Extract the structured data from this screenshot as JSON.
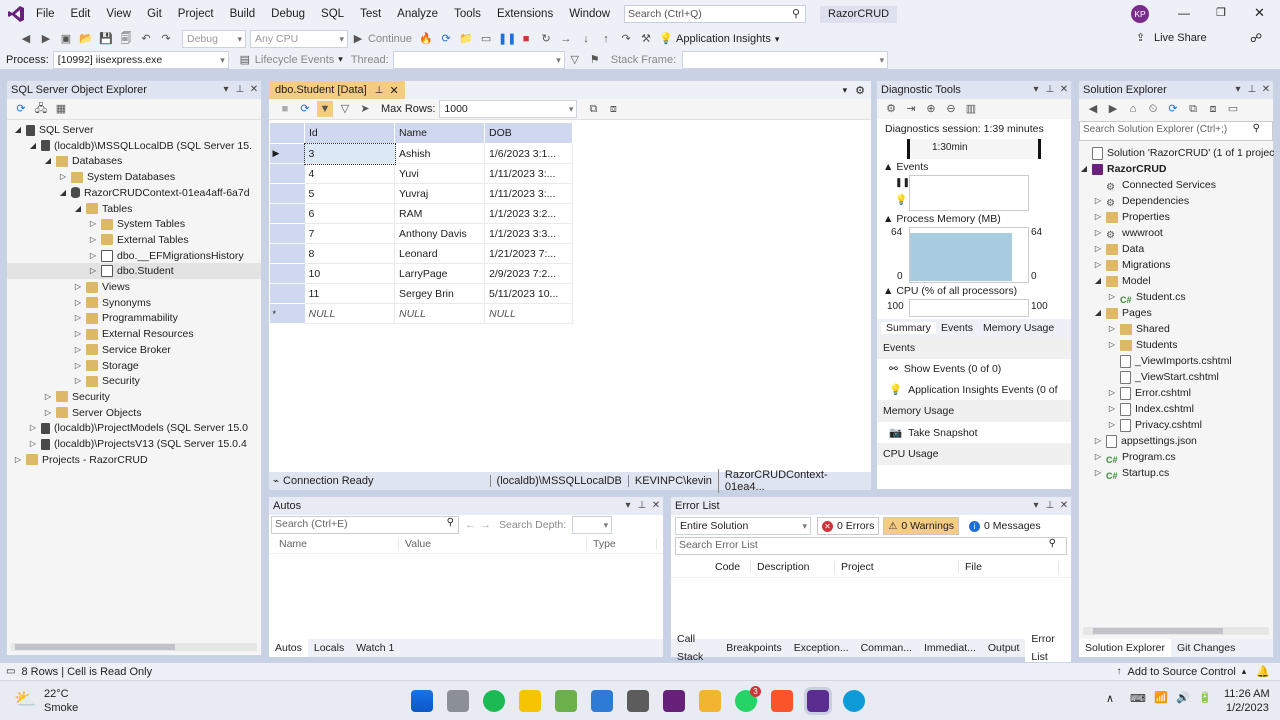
{
  "menu": {
    "items": [
      "File",
      "Edit",
      "View",
      "Git",
      "Project",
      "Build",
      "Debug",
      "SQL",
      "Test",
      "Analyze",
      "Tools",
      "Extensions",
      "Window",
      "Help"
    ],
    "search_placeholder": "Search (Ctrl+Q)",
    "solution_name": "RazorCRUD",
    "user_initials": "KP"
  },
  "toolbar": {
    "config": "Debug",
    "platform": "Any CPU",
    "continue_label": "Continue",
    "app_insights": "Application Insights",
    "live_share": "Live Share"
  },
  "toolbar2": {
    "process_label": "Process:",
    "process_value": "[10992] iisexpress.exe",
    "lifecycle": "Lifecycle Events",
    "thread_label": "Thread:",
    "stack_frame_label": "Stack Frame:"
  },
  "sql_explorer": {
    "title": "SQL Server Object Explorer",
    "nodes": [
      {
        "label": "SQL Server",
        "indent": 0,
        "arrow": "◢",
        "icon": "server"
      },
      {
        "label": "(localdb)\\MSSQLLocalDB (SQL Server 15.",
        "indent": 1,
        "arrow": "◢",
        "icon": "server"
      },
      {
        "label": "Databases",
        "indent": 2,
        "arrow": "◢",
        "icon": "folder"
      },
      {
        "label": "System Databases",
        "indent": 3,
        "arrow": "▷",
        "icon": "folder"
      },
      {
        "label": "RazorCRUDContext-01ea4aff-6a7d",
        "indent": 3,
        "arrow": "◢",
        "icon": "db"
      },
      {
        "label": "Tables",
        "indent": 4,
        "arrow": "◢",
        "icon": "folder"
      },
      {
        "label": "System Tables",
        "indent": 5,
        "arrow": "▷",
        "icon": "folder"
      },
      {
        "label": "External Tables",
        "indent": 5,
        "arrow": "▷",
        "icon": "folder"
      },
      {
        "label": "dbo.__EFMigrationsHistory",
        "indent": 5,
        "arrow": "▷",
        "icon": "table"
      },
      {
        "label": "dbo.Student",
        "indent": 5,
        "arrow": "▷",
        "icon": "table",
        "selected": true
      },
      {
        "label": "Views",
        "indent": 4,
        "arrow": "▷",
        "icon": "folder"
      },
      {
        "label": "Synonyms",
        "indent": 4,
        "arrow": "▷",
        "icon": "folder"
      },
      {
        "label": "Programmability",
        "indent": 4,
        "arrow": "▷",
        "icon": "folder"
      },
      {
        "label": "External Resources",
        "indent": 4,
        "arrow": "▷",
        "icon": "folder"
      },
      {
        "label": "Service Broker",
        "indent": 4,
        "arrow": "▷",
        "icon": "folder"
      },
      {
        "label": "Storage",
        "indent": 4,
        "arrow": "▷",
        "icon": "folder"
      },
      {
        "label": "Security",
        "indent": 4,
        "arrow": "▷",
        "icon": "folder"
      },
      {
        "label": "Security",
        "indent": 2,
        "arrow": "▷",
        "icon": "folder"
      },
      {
        "label": "Server Objects",
        "indent": 2,
        "arrow": "▷",
        "icon": "folder"
      },
      {
        "label": "(localdb)\\ProjectModels (SQL Server 15.0",
        "indent": 1,
        "arrow": "▷",
        "icon": "server"
      },
      {
        "label": "(localdb)\\ProjectsV13 (SQL Server 15.0.4",
        "indent": 1,
        "arrow": "▷",
        "icon": "server"
      },
      {
        "label": "Projects - RazorCRUD",
        "indent": 0,
        "arrow": "▷",
        "icon": "folder"
      }
    ]
  },
  "data_grid": {
    "tab_title": "dbo.Student [Data]",
    "max_rows_label": "Max Rows:",
    "max_rows_value": "1000",
    "columns": [
      "Id",
      "Name",
      "DOB"
    ],
    "rows": [
      [
        "3",
        "Ashish",
        "1/6/2023 3:1..."
      ],
      [
        "4",
        "Yuvi",
        "1/11/2023 3:..."
      ],
      [
        "5",
        "Yuvraj",
        "1/11/2023 3:..."
      ],
      [
        "6",
        "RAM",
        "1/1/2023 3:2..."
      ],
      [
        "7",
        "Anthony Davis",
        "1/1/2023 3:3..."
      ],
      [
        "8",
        "Leonard",
        "1/21/2023 7:..."
      ],
      [
        "10",
        "LarryPage",
        "2/9/2023 7:2..."
      ],
      [
        "11",
        "Sergey Brin",
        "5/11/2023 10..."
      ]
    ],
    "null_row": [
      "NULL",
      "NULL",
      "NULL"
    ],
    "new_row_marker": "*",
    "status_ready": "Connection Ready",
    "status_server": "(localdb)\\MSSQLLocalDB",
    "status_user": "KEVINPC\\kevin",
    "status_db": "RazorCRUDContext-01ea4..."
  },
  "diagnostics": {
    "title": "Diagnostic Tools",
    "session": "Diagnostics session: 1:39 minutes",
    "timeline_label": "1:30min",
    "events_label": "Events",
    "memory_label": "Process Memory (MB)",
    "mem_max": "64",
    "mem_min": "0",
    "cpu_label": "CPU (% of all processors)",
    "cpu_max": "100",
    "tabs": [
      "Summary",
      "Events",
      "Memory Usage"
    ],
    "summary_events_heading": "Events",
    "show_events": "Show Events (0 of 0)",
    "ai_events": "Application Insights Events (0 of",
    "memory_usage_heading": "Memory Usage",
    "take_snapshot": "Take Snapshot",
    "cpu_usage_heading": "CPU Usage"
  },
  "solution_explorer": {
    "title": "Solution Explorer",
    "search_placeholder": "Search Solution Explorer (Ctrl+;)",
    "nodes": [
      {
        "label": "Solution 'RazorCRUD' (1 of 1 projec",
        "indent": 0,
        "arrow": "",
        "icon": "file"
      },
      {
        "label": "RazorCRUD",
        "indent": 0,
        "arrow": "◢",
        "icon": "proj",
        "bold": true
      },
      {
        "label": "Connected Services",
        "indent": 1,
        "arrow": "",
        "icon": "gear"
      },
      {
        "label": "Dependencies",
        "indent": 1,
        "arrow": "▷",
        "icon": "gear"
      },
      {
        "label": "Properties",
        "indent": 1,
        "arrow": "▷",
        "icon": "folder"
      },
      {
        "label": "wwwroot",
        "indent": 1,
        "arrow": "▷",
        "icon": "gear"
      },
      {
        "label": "Data",
        "indent": 1,
        "arrow": "▷",
        "icon": "folder"
      },
      {
        "label": "Migrations",
        "indent": 1,
        "arrow": "▷",
        "icon": "folder"
      },
      {
        "label": "Model",
        "indent": 1,
        "arrow": "◢",
        "icon": "folder"
      },
      {
        "label": "Student.cs",
        "indent": 2,
        "arrow": "▷",
        "icon": "cs"
      },
      {
        "label": "Pages",
        "indent": 1,
        "arrow": "◢",
        "icon": "folder"
      },
      {
        "label": "Shared",
        "indent": 2,
        "arrow": "▷",
        "icon": "folder"
      },
      {
        "label": "Students",
        "indent": 2,
        "arrow": "▷",
        "icon": "folder"
      },
      {
        "label": "_ViewImports.cshtml",
        "indent": 2,
        "arrow": "",
        "icon": "file"
      },
      {
        "label": "_ViewStart.cshtml",
        "indent": 2,
        "arrow": "",
        "icon": "file"
      },
      {
        "label": "Error.cshtml",
        "indent": 2,
        "arrow": "▷",
        "icon": "file"
      },
      {
        "label": "Index.cshtml",
        "indent": 2,
        "arrow": "▷",
        "icon": "file"
      },
      {
        "label": "Privacy.cshtml",
        "indent": 2,
        "arrow": "▷",
        "icon": "file"
      },
      {
        "label": "appsettings.json",
        "indent": 1,
        "arrow": "▷",
        "icon": "file"
      },
      {
        "label": "Program.cs",
        "indent": 1,
        "arrow": "▷",
        "icon": "cs"
      },
      {
        "label": "Startup.cs",
        "indent": 1,
        "arrow": "▷",
        "icon": "cs"
      }
    ],
    "tabs": [
      "Solution Explorer",
      "Git Changes"
    ]
  },
  "autos": {
    "title": "Autos",
    "search_placeholder": "Search (Ctrl+E)",
    "search_depth": "Search Depth:",
    "columns": [
      "Name",
      "Value",
      "Type"
    ],
    "tabs": [
      "Autos",
      "Locals",
      "Watch 1"
    ]
  },
  "error_list": {
    "title": "Error List",
    "scope": "Entire Solution",
    "errors": "0 Errors",
    "warnings": "0 Warnings",
    "messages": "0 Messages",
    "search_placeholder": "Search Error List",
    "columns": [
      "Code",
      "Description",
      "Project",
      "File"
    ],
    "tabs": [
      "Call Stack",
      "Breakpoints",
      "Exception...",
      "Comman...",
      "Immediat...",
      "Output",
      "Error List"
    ]
  },
  "statusbar": {
    "left": "8 Rows | Cell is Read Only",
    "right": "Add to Source Control"
  },
  "taskbar": {
    "temp": "22°C",
    "weather": "Smoke",
    "time": "11:26 AM",
    "date": "1/2/2023",
    "whatsapp_badge": "3"
  },
  "colors": {
    "accent": "#68217a",
    "selection": "#cce0f7",
    "header": "#dfe4f1",
    "error": "#d13438",
    "warning": "#f2c94c",
    "info": "#1e6fd9"
  }
}
